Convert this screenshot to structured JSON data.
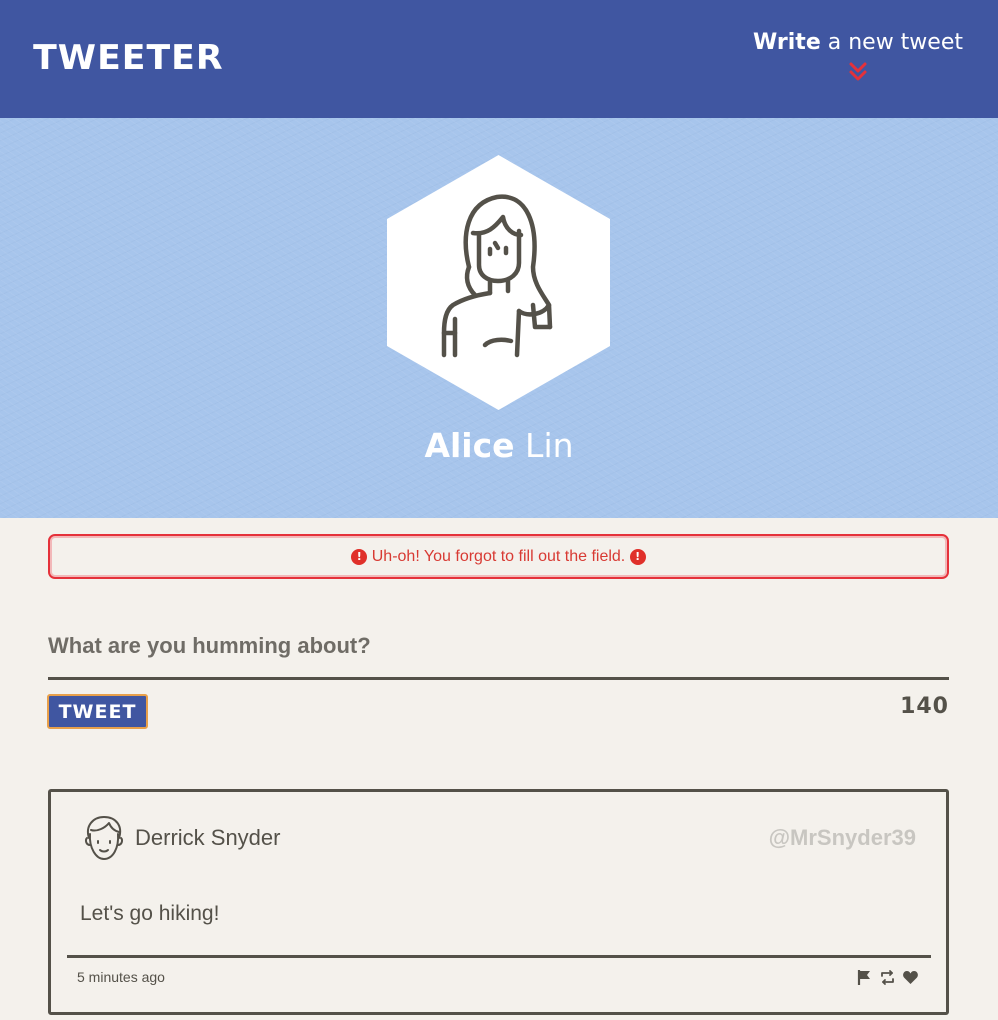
{
  "nav": {
    "logo": "TWEETER",
    "compose_bold": "Write",
    "compose_rest": " a new tweet",
    "compose_icon": "double-chevron-down-icon",
    "accent_color": "#e5313a"
  },
  "profile": {
    "first_name": "Alice",
    "last_name": " Lin",
    "avatar_icon": "woman-avatar-icon"
  },
  "error": {
    "message": " Uh-oh! You forgot to fill out the field. ",
    "icon": "exclamation-circle-icon"
  },
  "compose": {
    "placeholder": "What are you humming about?",
    "value": "",
    "button_label": "TWEET",
    "counter": "140"
  },
  "tweets": [
    {
      "name": "Derrick Snyder",
      "handle": "@MrSnyder39",
      "content": "Let's go hiking!",
      "time": "5 minutes ago",
      "avatar_icon": "man-avatar-icon",
      "actions": [
        "flag-icon",
        "retweet-icon",
        "heart-icon"
      ]
    }
  ],
  "colors": {
    "nav_bg": "#4056a1",
    "hero_bg": "#a7c5ec",
    "page_bg": "#f4f1ec",
    "text": "#545149",
    "handle": "#c8c6c1"
  }
}
